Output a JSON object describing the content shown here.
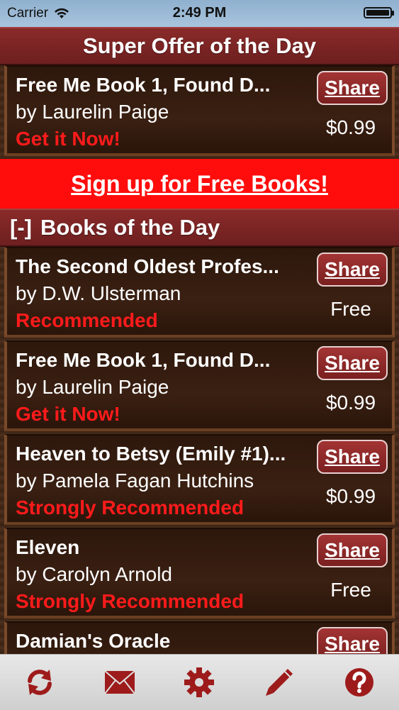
{
  "status_bar": {
    "carrier": "Carrier",
    "time": "2:49 PM"
  },
  "super_offer": {
    "header": "Super Offer of the Day",
    "book": {
      "title": "Free Me Book 1, Found D...",
      "author": "by Laurelin Paige",
      "tag": "Get it Now!",
      "share_label": "Share",
      "price": "$0.99"
    }
  },
  "signup": {
    "label": "Sign up for Free Books!"
  },
  "books_of_day": {
    "toggle": "[-]",
    "header": "Books of the Day",
    "books": [
      {
        "title": "The Second Oldest Profes...",
        "author": "by D.W. Ulsterman",
        "tag": "Recommended",
        "share_label": "Share",
        "price": "Free"
      },
      {
        "title": "Free Me Book 1, Found D...",
        "author": "by Laurelin Paige",
        "tag": "Get it Now!",
        "share_label": "Share",
        "price": "$0.99"
      },
      {
        "title": "Heaven to Betsy (Emily #1)...",
        "author": "by Pamela Fagan Hutchins",
        "tag": "Strongly Recommended",
        "share_label": "Share",
        "price": "$0.99"
      },
      {
        "title": "Eleven",
        "author": "by Carolyn Arnold",
        "tag": "Strongly Recommended",
        "share_label": "Share",
        "price": "Free"
      },
      {
        "title": "Damian's Oracle",
        "author": "",
        "tag": "",
        "share_label": "Share",
        "price": ""
      }
    ]
  },
  "tab_bar": {
    "icons": [
      "refresh-icon",
      "mail-icon",
      "gear-icon",
      "pencil-icon",
      "help-icon"
    ],
    "icon_color": "#9e1b1b"
  },
  "colors": {
    "header_bg": "#7a2323",
    "banner_bg": "#ff0d0d",
    "tag_red": "#ff1b1b"
  }
}
